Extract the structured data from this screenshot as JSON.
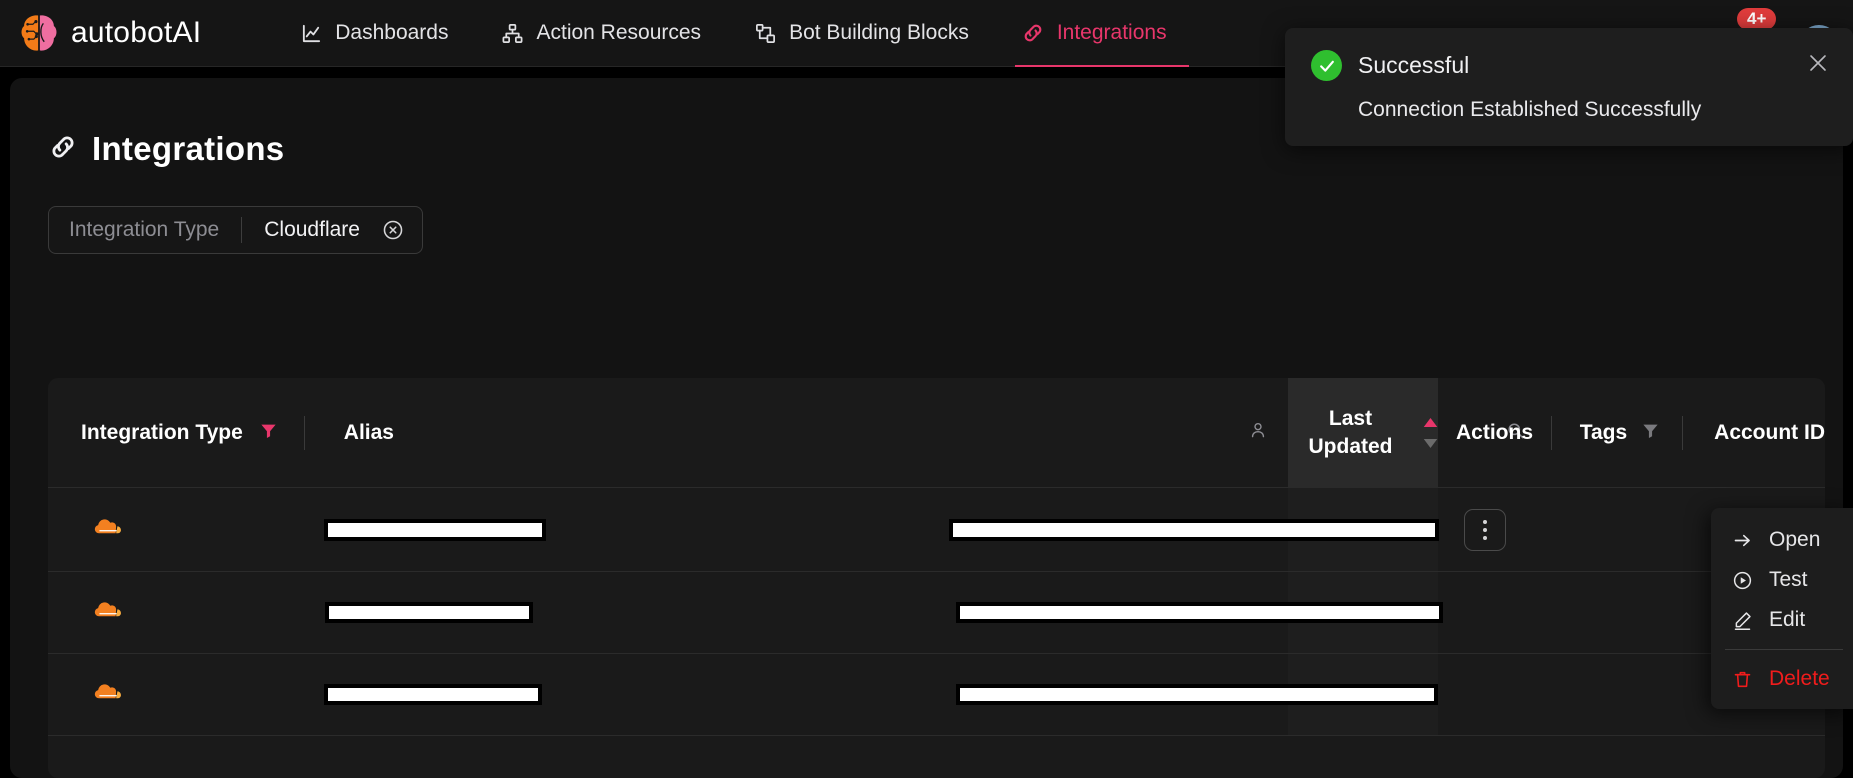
{
  "brand": {
    "name": "autobotAI",
    "logo_icon": "brain-circuit-logo"
  },
  "nav": {
    "items": [
      {
        "label": "Dashboards",
        "icon": "chart-line-icon",
        "active": false
      },
      {
        "label": "Action Resources",
        "icon": "sitemap-icon",
        "active": false
      },
      {
        "label": "Bot Building Blocks",
        "icon": "workflow-icon",
        "active": false
      },
      {
        "label": "Integrations",
        "icon": "link-chain-icon",
        "active": true
      }
    ],
    "notification_badge": "4+",
    "avatar_icon": "user-avatar"
  },
  "toast": {
    "icon": "check-circle-icon",
    "title": "Successful",
    "message": "Connection Established Successfully",
    "close_icon": "close-icon",
    "accent_color": "#2fbf2f"
  },
  "page": {
    "title": "Integrations",
    "title_icon": "link-chain-icon"
  },
  "filter_chip": {
    "key": "Integration Type",
    "value": "Cloudflare",
    "clear_icon": "circle-x-icon"
  },
  "table": {
    "columns": [
      {
        "label": "Integration Type",
        "filter_icon": "filter-funnel-icon",
        "filter_active": true
      },
      {
        "label": "Alias",
        "filter_icon": null,
        "filter_active": false
      },
      {
        "label": "Tags",
        "filter_icon": "filter-funnel-icon",
        "filter_active": false
      },
      {
        "label": "Account ID",
        "filter_icon": null,
        "filter_active": false
      },
      {
        "label": "Last Updated",
        "filter_icon": null,
        "filter_active": false
      },
      {
        "label": "Actions",
        "filter_icon": null,
        "filter_active": false
      }
    ],
    "search_icon": "search-icon",
    "person_icon": "user-icon",
    "sort": {
      "column": "Last Updated",
      "direction": "asc",
      "asc_color": "#e8366b",
      "desc_color": "#6b6b6b"
    },
    "rows": [
      {
        "integration_icon": "cloudflare-icon",
        "alias": "",
        "tags": "",
        "account_id": "",
        "last_updated": "",
        "actions_icon": "kebab-menu-icon"
      },
      {
        "integration_icon": "cloudflare-icon",
        "alias": "",
        "tags": "",
        "account_id": "",
        "last_updated": "",
        "actions_icon": "kebab-menu-icon"
      },
      {
        "integration_icon": "cloudflare-icon",
        "alias": "",
        "tags": "",
        "account_id": "",
        "last_updated": "",
        "actions_icon": "kebab-menu-icon"
      }
    ]
  },
  "row_menu": {
    "items": [
      {
        "label": "Open",
        "icon": "arrow-right-icon",
        "danger": false
      },
      {
        "label": "Test",
        "icon": "play-circle-icon",
        "danger": false
      },
      {
        "label": "Edit",
        "icon": "pencil-icon",
        "danger": false
      },
      {
        "label": "Delete",
        "icon": "trash-icon",
        "danger": true
      }
    ],
    "danger_color": "#f01c1c"
  },
  "theme": {
    "accent": "#e8366b",
    "background": "#000000",
    "surface": "#131313",
    "table_surface": "#1a1a1a"
  }
}
